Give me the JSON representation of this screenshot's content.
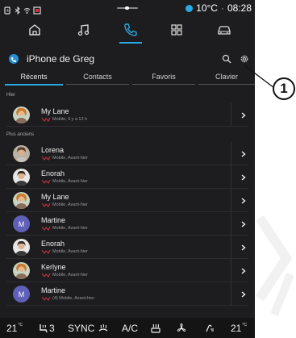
{
  "status": {
    "temperature": "10°C",
    "separator": "·",
    "time": "08:28"
  },
  "nav": {
    "items": [
      {
        "name": "home"
      },
      {
        "name": "music"
      },
      {
        "name": "phone",
        "active": true
      },
      {
        "name": "apps"
      },
      {
        "name": "car"
      }
    ]
  },
  "header": {
    "title": "iPhone de Greg"
  },
  "tabs": [
    "Récents",
    "Contacts",
    "Favoris",
    "Clavier"
  ],
  "sections": {
    "recent": "Hier",
    "older": "Plus anciens"
  },
  "recent_calls": [
    {
      "name": "My Lane",
      "detail": "Mobile, Il y a 12 h",
      "avatar": "photo-1"
    }
  ],
  "older_calls": [
    {
      "name": "Lorena",
      "detail": "Mobile, Avant-hier",
      "avatar": "photo-2"
    },
    {
      "name": "Enorah",
      "detail": "Mobile, Avant-hier",
      "avatar": "photo-3"
    },
    {
      "name": "My Lane",
      "detail": "Mobile, Avant-hier",
      "avatar": "photo-1"
    },
    {
      "name": "Martine",
      "detail": "Mobile, Avant-hier",
      "avatar": "initial",
      "initial": "M"
    },
    {
      "name": "Enorah",
      "detail": "Mobile, Avant-hier",
      "avatar": "photo-3"
    },
    {
      "name": "Kerlyne",
      "detail": "Mobile, Avant-hier",
      "avatar": "photo-1"
    },
    {
      "name": "Martine",
      "detail": "(4) Mobile, Avant-hier",
      "avatar": "initial",
      "initial": "M"
    }
  ],
  "climate": {
    "left_temp": "21",
    "left_unit": "°C",
    "seat_level": "3",
    "sync": "SYNC",
    "ac": "A/C",
    "right_temp": "21",
    "right_unit": "°C"
  },
  "callout": {
    "number": "1"
  },
  "colors": {
    "accent": "#29a9e0",
    "missed": "#d6334a",
    "background": "#1d1d1f"
  }
}
